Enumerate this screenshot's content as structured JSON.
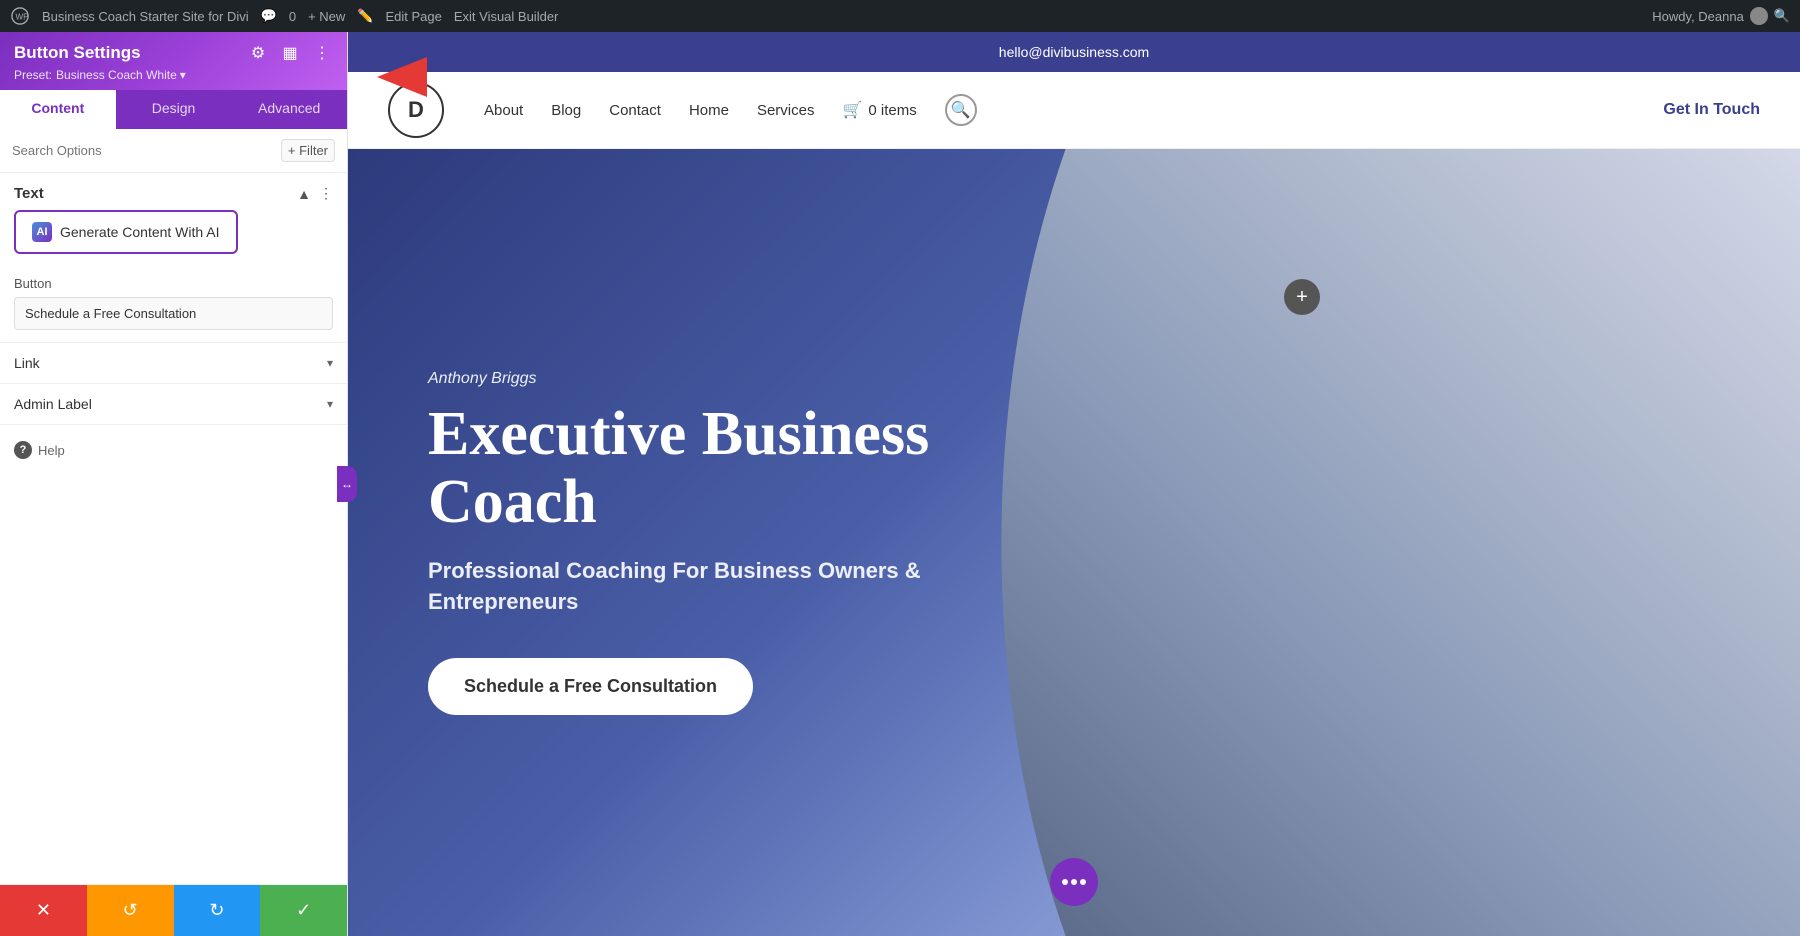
{
  "admin_bar": {
    "site_name": "Business Coach Starter Site for Divi",
    "comments": "0",
    "new_label": "+ New",
    "edit_page": "Edit Page",
    "exit_builder": "Exit Visual Builder",
    "howdy": "Howdy, Deanna",
    "search_icon": "search-icon"
  },
  "panel": {
    "title": "Button Settings",
    "preset_label": "Preset:",
    "preset_value": "Business Coach White",
    "tabs": [
      {
        "label": "Content",
        "active": true
      },
      {
        "label": "Design",
        "active": false
      },
      {
        "label": "Advanced",
        "active": false
      }
    ],
    "search_placeholder": "Search Options",
    "filter_label": "+ Filter",
    "text_section": {
      "title": "Text",
      "generate_ai_label": "Generate Content With AI"
    },
    "button_section": {
      "label": "Button",
      "value": "Schedule a Free Consultation"
    },
    "link_section": {
      "title": "Link"
    },
    "admin_label_section": {
      "title": "Admin Label"
    },
    "help_label": "Help"
  },
  "footer_buttons": {
    "cancel": "✕",
    "undo": "↺",
    "redo": "↻",
    "save": "✓"
  },
  "site": {
    "email": "hello@divibusiness.com",
    "logo_text": "D",
    "nav": [
      {
        "label": "About"
      },
      {
        "label": "Blog"
      },
      {
        "label": "Contact"
      },
      {
        "label": "Home"
      },
      {
        "label": "Services"
      }
    ],
    "cart_label": "0 items",
    "cta_label": "Get In Touch"
  },
  "hero": {
    "author": "Anthony Briggs",
    "title_line1": "Executive Business",
    "title_line2": "Coach",
    "subtitle": "Professional Coaching For Business Owners & Entrepreneurs",
    "cta_button": "Schedule a Free Consultation"
  }
}
